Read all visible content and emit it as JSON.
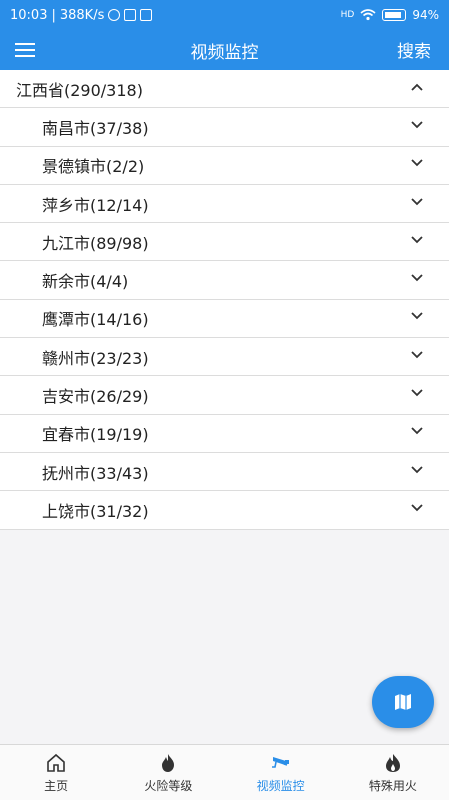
{
  "status_bar": {
    "time": "10:03",
    "speed": "388K/s",
    "signal": "HD",
    "battery": "94%"
  },
  "app_bar": {
    "title": "视频监控",
    "search_label": "搜索"
  },
  "province": {
    "label": "江西省(290/318)",
    "expanded": true
  },
  "cities": [
    {
      "label": "南昌市(37/38)"
    },
    {
      "label": "景德镇市(2/2)"
    },
    {
      "label": "萍乡市(12/14)"
    },
    {
      "label": "九江市(89/98)"
    },
    {
      "label": "新余市(4/4)"
    },
    {
      "label": "鹰潭市(14/16)"
    },
    {
      "label": "赣州市(23/23)"
    },
    {
      "label": "吉安市(26/29)"
    },
    {
      "label": "宜春市(19/19)"
    },
    {
      "label": "抚州市(33/43)"
    },
    {
      "label": "上饶市(31/32)"
    }
  ],
  "fab": {
    "icon": "map-icon"
  },
  "bottom_nav": [
    {
      "label": "主页",
      "icon": "home-icon",
      "active": false
    },
    {
      "label": "火险等级",
      "icon": "fire-risk-icon",
      "active": false
    },
    {
      "label": "视频监控",
      "icon": "camera-icon",
      "active": true
    },
    {
      "label": "特殊用火",
      "icon": "flame-icon",
      "active": false
    }
  ],
  "colors": {
    "primary": "#2a8ee8",
    "background": "#f4f4f6"
  }
}
